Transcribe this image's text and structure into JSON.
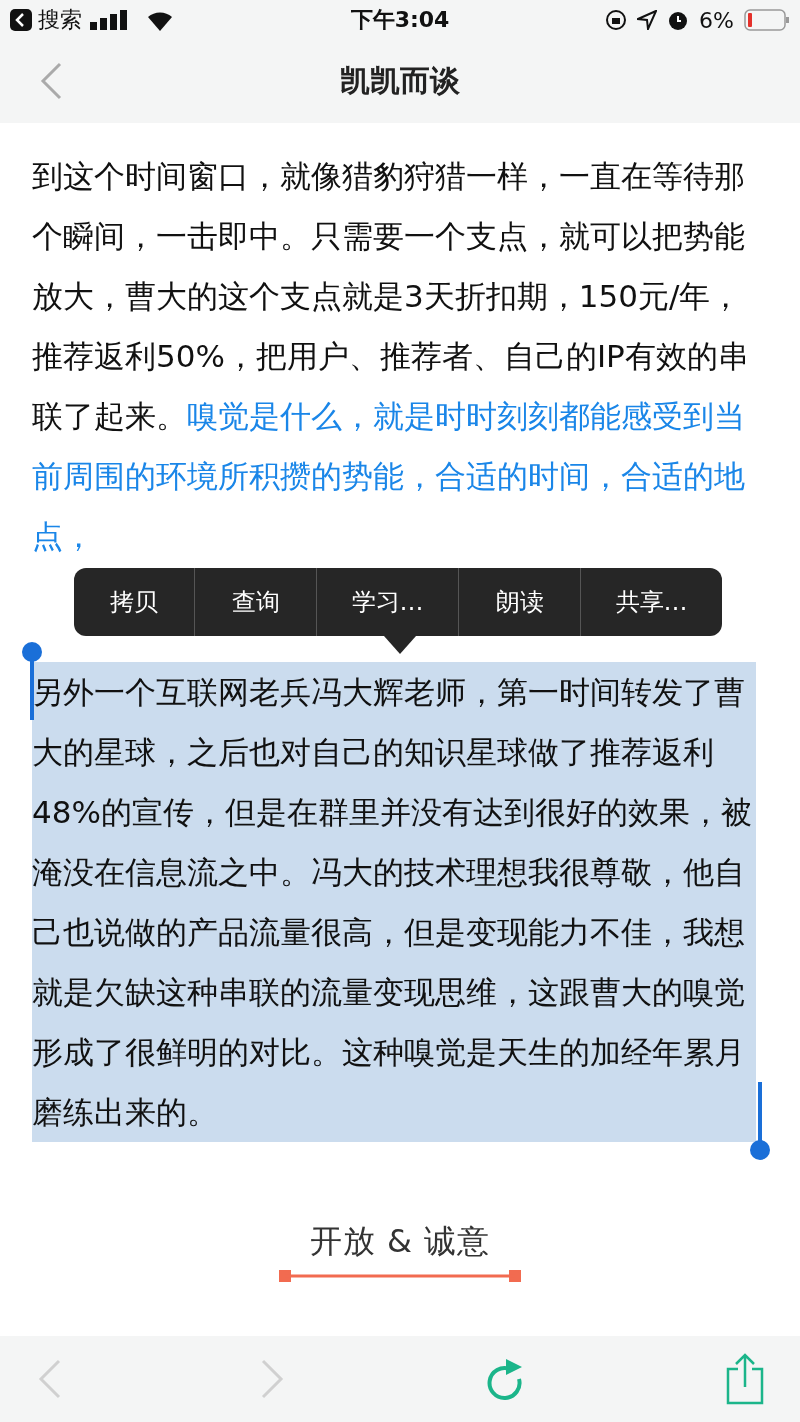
{
  "status_bar": {
    "back_app": "搜索",
    "time": "下午3:04",
    "battery_percent": "6%"
  },
  "nav": {
    "title": "凯凯而谈"
  },
  "article": {
    "paragraphs": [
      {
        "selected": false,
        "segments": [
          {
            "text": "到这个时间窗口，就像猎豹狩猎一样，一直在等待那个瞬间，一击即中。只需要一个支点，就可以把势能放大，曹大的这个支点就是3天折扣期，150元/年，推荐返利50%，把用户、推荐者、自己的IP有效的串联了起来。",
            "emphasis": false
          },
          {
            "text": "嗅觉是什么，就是时时刻刻都能感受到当前周围的环境所积攒的势能，合适的时间，合适的地点，",
            "emphasis": true
          }
        ]
      },
      {
        "selected": true,
        "segments": [
          {
            "text": "另外一个互联网老兵冯大辉老师，第一时间转发了曹大的星球，之后也对自己的知识星球做了推荐返利48%的宣传，但是在群里并没有达到很好的效果，被淹没在信息流之中。冯大的技术理想我很尊敬，他自己也说做的产品流量很高，但是变现能力不佳，我想就是欠缺这种串联的流量变现思维，这跟曹大的嗅觉形成了很鲜明的对比。这种嗅觉是天生的加经年累月磨练出来的。",
            "emphasis": false
          }
        ]
      }
    ]
  },
  "context_menu": {
    "items": [
      "拷贝",
      "查询",
      "学习…",
      "朗读",
      "共享…"
    ]
  },
  "footer": {
    "heading": "开放 & 诚意"
  },
  "toolbar": {
    "items": [
      {
        "kind": "back",
        "disabled": true
      },
      {
        "kind": "forward",
        "disabled": true
      },
      {
        "kind": "refresh",
        "disabled": false
      },
      {
        "kind": "share",
        "disabled": false
      }
    ]
  }
}
